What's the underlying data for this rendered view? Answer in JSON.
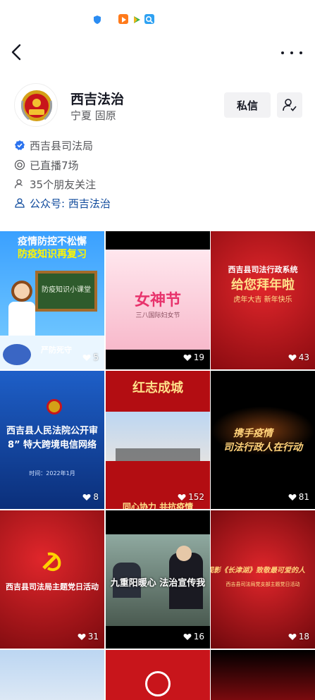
{
  "status_bar": {
    "icons": [
      "shield-icon",
      "play-app-icon",
      "play-app-icon-2",
      "search-app-icon"
    ]
  },
  "profile": {
    "name": "西吉法治",
    "location": "宁夏 固原",
    "message_label": "私信",
    "verified_text": "西吉县司法局",
    "live_text": "已直播7场",
    "friends_text": "35个朋友关注",
    "official_account_text": "公众号: 西吉法治"
  },
  "videos": [
    {
      "likes": "5",
      "top": "疫情防控不松懈",
      "sub": "防疫知识再复习",
      "board": "防疫知识小课堂",
      "bottom": "严防死守"
    },
    {
      "likes": "19",
      "title": "女神节",
      "sub": "三八国际妇女节"
    },
    {
      "likes": "43",
      "head": "西吉县司法行政系统",
      "title": "给您拜年啦",
      "sub": "虎年大吉 新年快乐"
    },
    {
      "likes": "8",
      "title": "西吉县人民法院公开审",
      "line2": "8” 特大跨境电信网络",
      "date": "时间：2022年1月"
    },
    {
      "likes": "152",
      "top": "红志成城",
      "bottom": "同心协力 共抗疫情"
    },
    {
      "likes": "81",
      "line1": "携手疫情",
      "line2": "司法行政人在行动"
    },
    {
      "likes": "31",
      "title": "西吉县司法局主题党日活动"
    },
    {
      "likes": "16",
      "title": "九重阳暖心 法治宣传我"
    },
    {
      "likes": "18",
      "title": "观影《长津湖》致敬最可爱的人",
      "sub": "西吉县司法局党支部主题党日活动"
    }
  ],
  "colors": {
    "accent_blue": "#0f4a9c",
    "verified": "#2b73ef",
    "red": "#c8151b"
  }
}
